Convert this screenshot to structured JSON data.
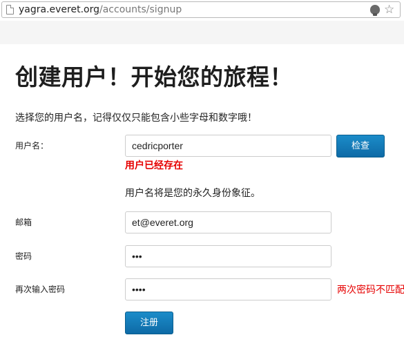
{
  "browser": {
    "url_host": "yagra.everet.org",
    "url_path": "/accounts/signup",
    "icons": [
      "page-icon",
      "lightbulb-icon",
      "star-icon"
    ]
  },
  "page": {
    "title": "创建用户！开始您的旅程！",
    "intro": "选择您的用户名，记得仅仅只能包含小些字母和数字哦！"
  },
  "form": {
    "username": {
      "label": "用户名：",
      "value": "cedricporter",
      "check_button": "检查",
      "error": "用户已经存在",
      "hint": "用户名将是您的永久身份象征。"
    },
    "email": {
      "label": "邮箱",
      "value": "et@everet.org"
    },
    "password": {
      "label": "密码",
      "value": "•••"
    },
    "password_confirm": {
      "label": "再次输入密码",
      "value": "••••",
      "error": "两次密码不匹配"
    },
    "submit_button": "注册"
  },
  "colors": {
    "error": "#e60000",
    "button": "#0e6aa6",
    "band": "#f5f5f5"
  }
}
